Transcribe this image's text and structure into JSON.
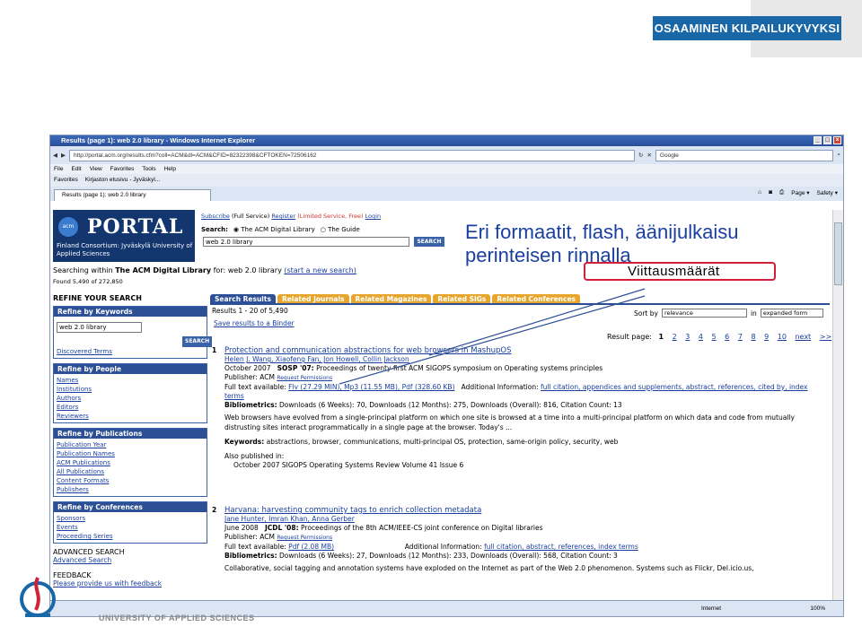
{
  "slide": {
    "banner": "OSAAMINEN KILPAILUKYVYKSI",
    "callout_lines": [
      "Eri formaatit, flash, äänijulkaisu",
      "perinteisen rinnalla"
    ],
    "citation_label": "Viittausmäärät",
    "footer": "UNIVERSITY OF APPLIED SCIENCES"
  },
  "browser": {
    "title": "Results (page 1): web 2.0 library - Windows Internet Explorer",
    "url": "http://portal.acm.org/results.cfm?coll=ACM&dl=ACM&CFID=82322398&CFTOKEN=72506162",
    "search_placeholder": "Google",
    "menu": [
      "File",
      "Edit",
      "View",
      "Favorites",
      "Tools",
      "Help"
    ],
    "favorites": [
      "Favorites",
      "Kirjaston etusivu - Jyväskyl..."
    ],
    "tab": "Results (page 1): web 2.0 library",
    "tools": [
      "Page ▾",
      "Safety ▾"
    ],
    "status_zone": "Internet",
    "zoom": "100%"
  },
  "portal": {
    "logo_acm": "acm",
    "logo_text": "PORTAL",
    "logo_sub": [
      "Finland Consortium: Jyväskylä University of",
      "Applied Sciences"
    ],
    "subscribe": "Subscribe",
    "full_service": "(Full Service)",
    "register": "Register",
    "limited": "(Limited Service, Free)",
    "login": "Login",
    "search_label": "Search:",
    "opt1": "The ACM Digital Library",
    "opt2": "The Guide",
    "query": "web 2.0 library",
    "search_btn": "SEARCH",
    "within_prefix": "Searching within",
    "within_lib": "The ACM Digital Library",
    "within_for": "for: web 2.0 library",
    "new_search": "(start a new search)",
    "found": "Found 5,490 of 272,850",
    "refine_title": "REFINE YOUR SEARCH",
    "kw_head": "Refine by Keywords",
    "kw_value": "web 2.0 library",
    "kw_btn": "SEARCH",
    "kw_link": "Discovered Terms",
    "people_head": "Refine by People",
    "people": [
      "Names",
      "Institutions",
      "Authors",
      "Editors",
      "Reviewers"
    ],
    "pub_head": "Refine by Publications",
    "pubs": [
      "Publication Year",
      "Publication Names",
      "ACM Publications",
      "All Publications",
      "Content Formats",
      "Publishers"
    ],
    "conf_head": "Refine by Conferences",
    "confs": [
      "Sponsors",
      "Events",
      "Proceeding Series"
    ],
    "adv_head": "ADVANCED SEARCH",
    "adv_link": "Advanced Search",
    "feedback_head": "FEEDBACK",
    "feedback_link": "Please provide us with feedback",
    "tabs": [
      "Search Results",
      "Related Journals",
      "Related Magazines",
      "Related SIGs",
      "Related Conferences"
    ],
    "results_info": "Results 1 - 20 of 5,490",
    "save": "Save results to a Binder",
    "sort_label": "Sort by",
    "sort_value": "relevance",
    "in_label": "in",
    "in_value": "expanded form",
    "page_label": "Result page:",
    "page_current": "1",
    "pages": [
      "2",
      "3",
      "4",
      "5",
      "6",
      "7",
      "8",
      "9",
      "10",
      "next",
      ">>"
    ]
  },
  "results": [
    {
      "num": "1",
      "title": "Protection and communication abstractions for web browsers in MashupOS",
      "authors": "Helen J. Wang, Xiaofeng Fan, Jon Howell, Collin Jackson",
      "date": "October 2007",
      "venue": "SOSP '07:",
      "venue_rest": " Proceedings of twenty-first ACM SIGOPS symposium on Operating systems principles",
      "publisher": "Publisher: ACM",
      "perm": "Request Permissions",
      "fulltext": "Full text available:",
      "formats": "Flv (27.29 MIN), Mp3 (11.55 MB), Pdf (328.60 KB)",
      "addl": "Additional Information:",
      "addl_links": "full citation, appendices and supplements, abstract, references, cited by, index terms",
      "biblio": "Bibliometrics:",
      "biblio_text": "Downloads (6 Weeks): 70,   Downloads (12 Months): 275,   Downloads (Overall): 816,   Citation Count: 13",
      "abstract": "Web browsers have evolved from a single-principal platform on which one site is browsed at a time into a multi-principal platform on which data and code from mutually distrusting sites interact programmatically in a single page at the browser. Today's ...",
      "keywords_label": "Keywords:",
      "keywords": "abstractions, browser, communications, multi-principal OS, protection, same-origin policy, security, web",
      "also": "Also published in:",
      "also_text": "October 2007 SIGOPS Operating Systems Review Volume 41 Issue 6"
    },
    {
      "num": "2",
      "title": "Harvana: harvesting community tags to enrich collection metadata",
      "authors": "Jane Hunter, Imran Khan, Anna Gerber",
      "date": "June 2008",
      "venue": "JCDL '08:",
      "venue_rest": " Proceedings of the 8th ACM/IEEE-CS joint conference on Digital libraries",
      "publisher": "Publisher: ACM",
      "perm": "Request Permissions",
      "fulltext": "Full text available:",
      "formats": "Pdf (2.08 MB)",
      "addl": "Additional Information:",
      "addl_links": "full citation, abstract, references, index terms",
      "biblio": "Bibliometrics:",
      "biblio_text": "Downloads (6 Weeks): 27,   Downloads (12 Months): 233,   Downloads (Overall): 568,   Citation Count: 3",
      "abstract": "Collaborative, social tagging and annotation systems have exploded on the Internet as part of the Web 2.0 phenomenon. Systems such as Flickr, Del.icio.us,"
    }
  ],
  "colors": {
    "brand": "#1a67a8",
    "portal_navy": "#13366e",
    "tab_orange": "#e7a52c",
    "highlight_red": "#d0203a",
    "callout_blue": "#1a3fa0"
  }
}
